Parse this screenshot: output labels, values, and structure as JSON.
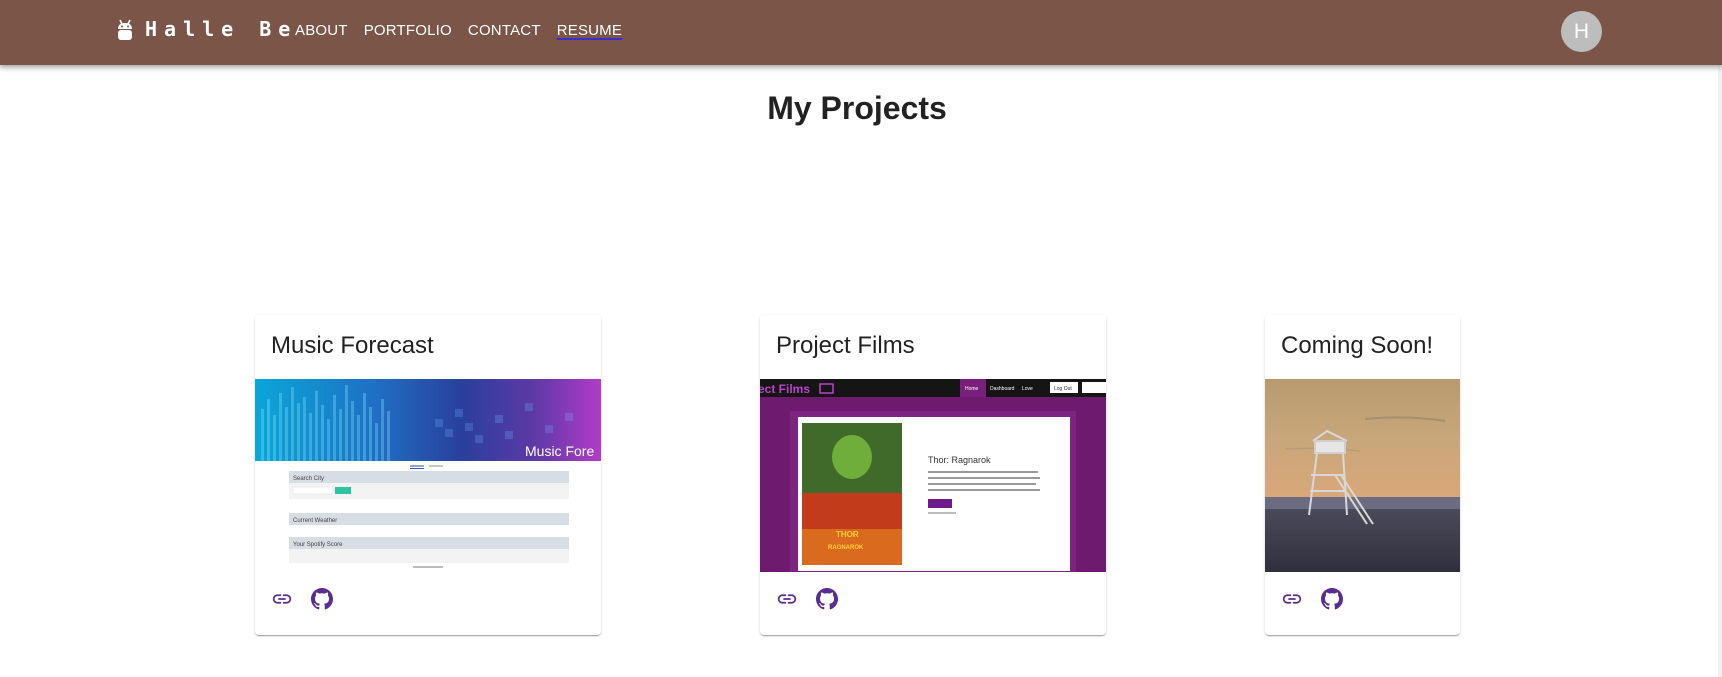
{
  "header": {
    "brand": "Halle Be",
    "nav": [
      {
        "label": "ABOUT"
      },
      {
        "label": "PORTFOLIO"
      },
      {
        "label": "CONTACT"
      },
      {
        "label": "RESUME"
      }
    ],
    "avatar_initial": "H",
    "bar_color": "#7a5548"
  },
  "main": {
    "title": "My Projects",
    "projects": [
      {
        "title": "Music Forecast",
        "banner_text": "Music Fore",
        "sections": [
          "Search City",
          "Current Weather",
          "Your Spotify Score"
        ]
      },
      {
        "title": "Project Films",
        "banner_text": "ect Films",
        "nav_items": [
          "Home",
          "Dashboard",
          "Love",
          "Log Out"
        ],
        "movie_title": "Thor: Ragnarok",
        "poster_top": "THOR",
        "poster_bottom": "RAGNAROK"
      },
      {
        "title": "Coming Soon!"
      }
    ]
  },
  "colors": {
    "accent_purple": "#5b2c91",
    "films_purple": "#7b1f7d",
    "avatar_grey": "#bdbdbd"
  },
  "icons": [
    "android-icon",
    "link-icon",
    "github-icon"
  ]
}
